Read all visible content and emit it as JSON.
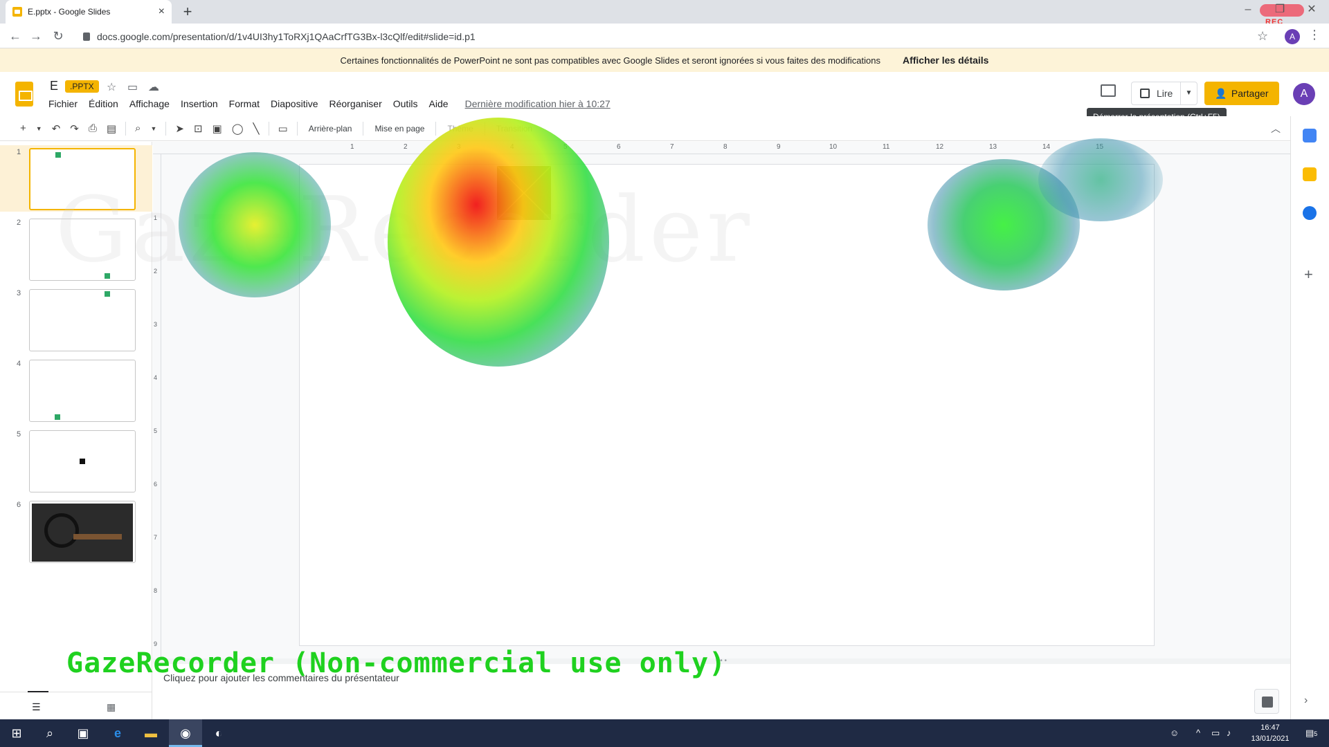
{
  "browser": {
    "tab_title": "E.pptx - Google Slides",
    "tab_close": "×",
    "new_tab": "+",
    "url": "docs.google.com/presentation/d/1v4UI3hy1ToRXj1QAaCrfTG3Bx-l3cQlf/edit#slide=id.p1",
    "profile_initial": "A",
    "rec_label": "REC",
    "window_controls": [
      "–",
      "❐",
      "✕"
    ]
  },
  "warning_bar": {
    "message": "Certaines fonctionnalités de PowerPoint ne sont pas compatibles avec Google Slides et seront ignorées si vous faites des modifications",
    "details_link": "Afficher les détails"
  },
  "document": {
    "name": "E",
    "badge": ".PPTX",
    "last_modified": "Dernière modification hier à 10:27"
  },
  "menu": [
    "Fichier",
    "Édition",
    "Affichage",
    "Insertion",
    "Format",
    "Diapositive",
    "Réorganiser",
    "Outils",
    "Aide"
  ],
  "header": {
    "present_label": "Lire",
    "share_label": "Partager",
    "user_initial": "A",
    "tooltip": "Démarrer la présentation (Ctrl+F5)"
  },
  "toolbar": {
    "background": "Arrière-plan",
    "layout": "Mise en page",
    "theme": "Thème",
    "transition": "Transition"
  },
  "slides": [
    {
      "number": "1"
    },
    {
      "number": "2"
    },
    {
      "number": "3"
    },
    {
      "number": "4"
    },
    {
      "number": "5"
    },
    {
      "number": "6"
    }
  ],
  "ruler": {
    "horizontal": [
      "1",
      "2",
      "3",
      "4",
      "5",
      "6",
      "7",
      "8",
      "9",
      "10",
      "11",
      "12",
      "13",
      "14",
      "15"
    ],
    "vertical": [
      "1",
      "2",
      "3",
      "4",
      "5",
      "6",
      "7",
      "8",
      "9"
    ]
  },
  "watermark_text": "GazeRecorder",
  "notes_placeholder": "Cliquez pour ajouter les commentaires du présentateur",
  "gaze_label": "GazeRecorder (Non-commercial use only)",
  "taskbar": {
    "time": "16:47",
    "date": "13/01/2021",
    "notification_count": "5"
  },
  "colors": {
    "accent": "#f4b400",
    "gaze_text": "#1fd11f",
    "warning_bg": "#fdf3d8",
    "taskbar_bg": "#1f2a44"
  }
}
